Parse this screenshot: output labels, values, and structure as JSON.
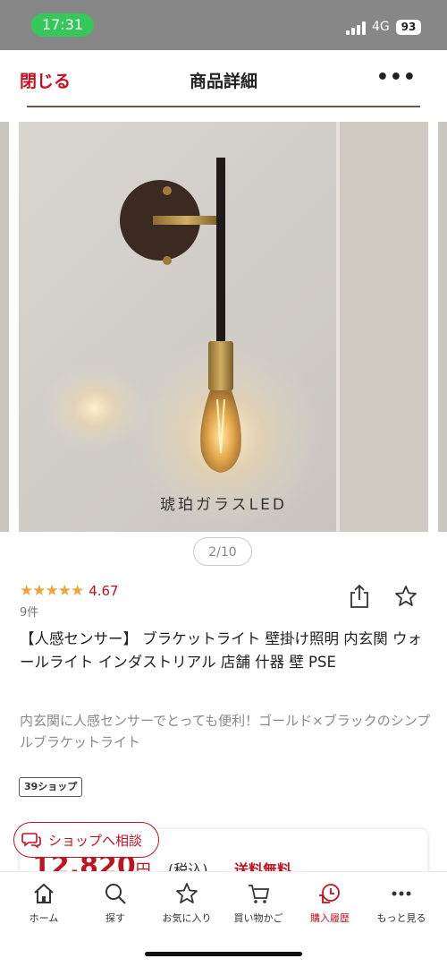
{
  "status_bar": {
    "time": "17:31",
    "network": "4G",
    "battery": "93"
  },
  "nav": {
    "close_label": "閉じる",
    "title": "商品詳細",
    "more_label": "•••"
  },
  "gallery": {
    "caption": "琥珀ガラスLED",
    "page_indicator": "2/10"
  },
  "product": {
    "rating_stars": "★★★★★",
    "rating_value": "4.67",
    "review_count": "9件",
    "title": "【人感センサー】 ブラケットライト 壁掛け照明 内玄関 ウォールライト インダストリアル 店舗 什器 壁 PSE",
    "description": "内玄関に人感センサーでとっても便利！ゴールド×ブラックのシンプルブラケットライト",
    "shop_tag": "39ショップ"
  },
  "price": {
    "amount": "12,820",
    "unit": "円",
    "tax": "(税込)",
    "shipping": "送料無料"
  },
  "consult": {
    "label": "ショップへ相談"
  },
  "tabs": [
    {
      "label": "ホーム",
      "icon": "home-icon"
    },
    {
      "label": "探す",
      "icon": "search-icon"
    },
    {
      "label": "お気に入り",
      "icon": "star-icon"
    },
    {
      "label": "買い物かご",
      "icon": "cart-icon"
    },
    {
      "label": "購入履歴",
      "icon": "history-icon"
    },
    {
      "label": "もっと見る",
      "icon": "more-icon"
    }
  ],
  "colors": {
    "accent": "#c1121f",
    "star": "#f2a33a",
    "status_pill": "#35c759"
  }
}
